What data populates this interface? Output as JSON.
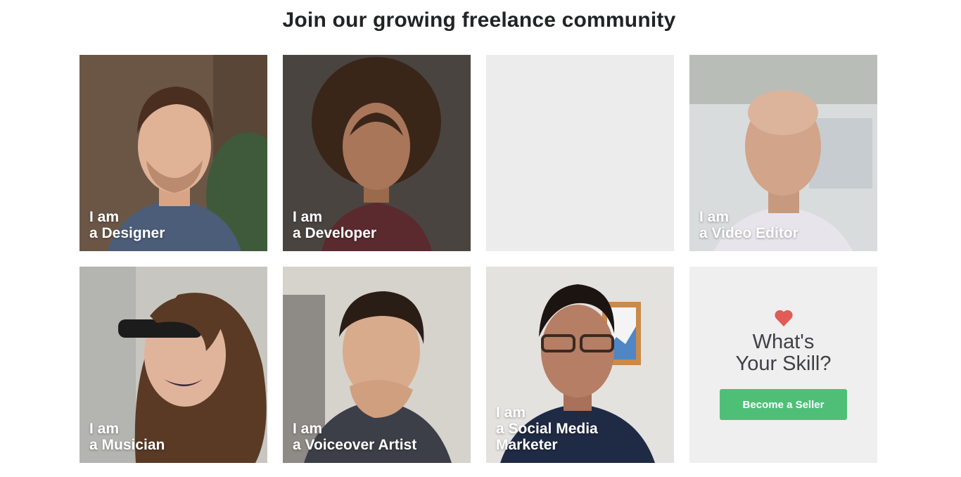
{
  "section": {
    "title": "Join our growing freelance community"
  },
  "cards": [
    {
      "line1": "I am",
      "line2": "a Designer"
    },
    {
      "line1": "I am",
      "line2": "a Developer"
    },
    {
      "line1": "I am",
      "line2": "a Video Editor"
    },
    {
      "line1": "I am",
      "line2": "a Musician"
    },
    {
      "line1": "I am",
      "line2": "a Voiceover Artist"
    },
    {
      "line1": "I am",
      "line2": "a Social Media",
      "line3": "Marketer"
    }
  ],
  "cta": {
    "icon": "heart-icon",
    "title_line1": "What's",
    "title_line2": "Your Skill?",
    "button_label": "Become a Seller"
  },
  "colors": {
    "accent_green": "#4fbf78",
    "heart_red": "#e15c56",
    "placeholder_gray": "#ececec"
  }
}
